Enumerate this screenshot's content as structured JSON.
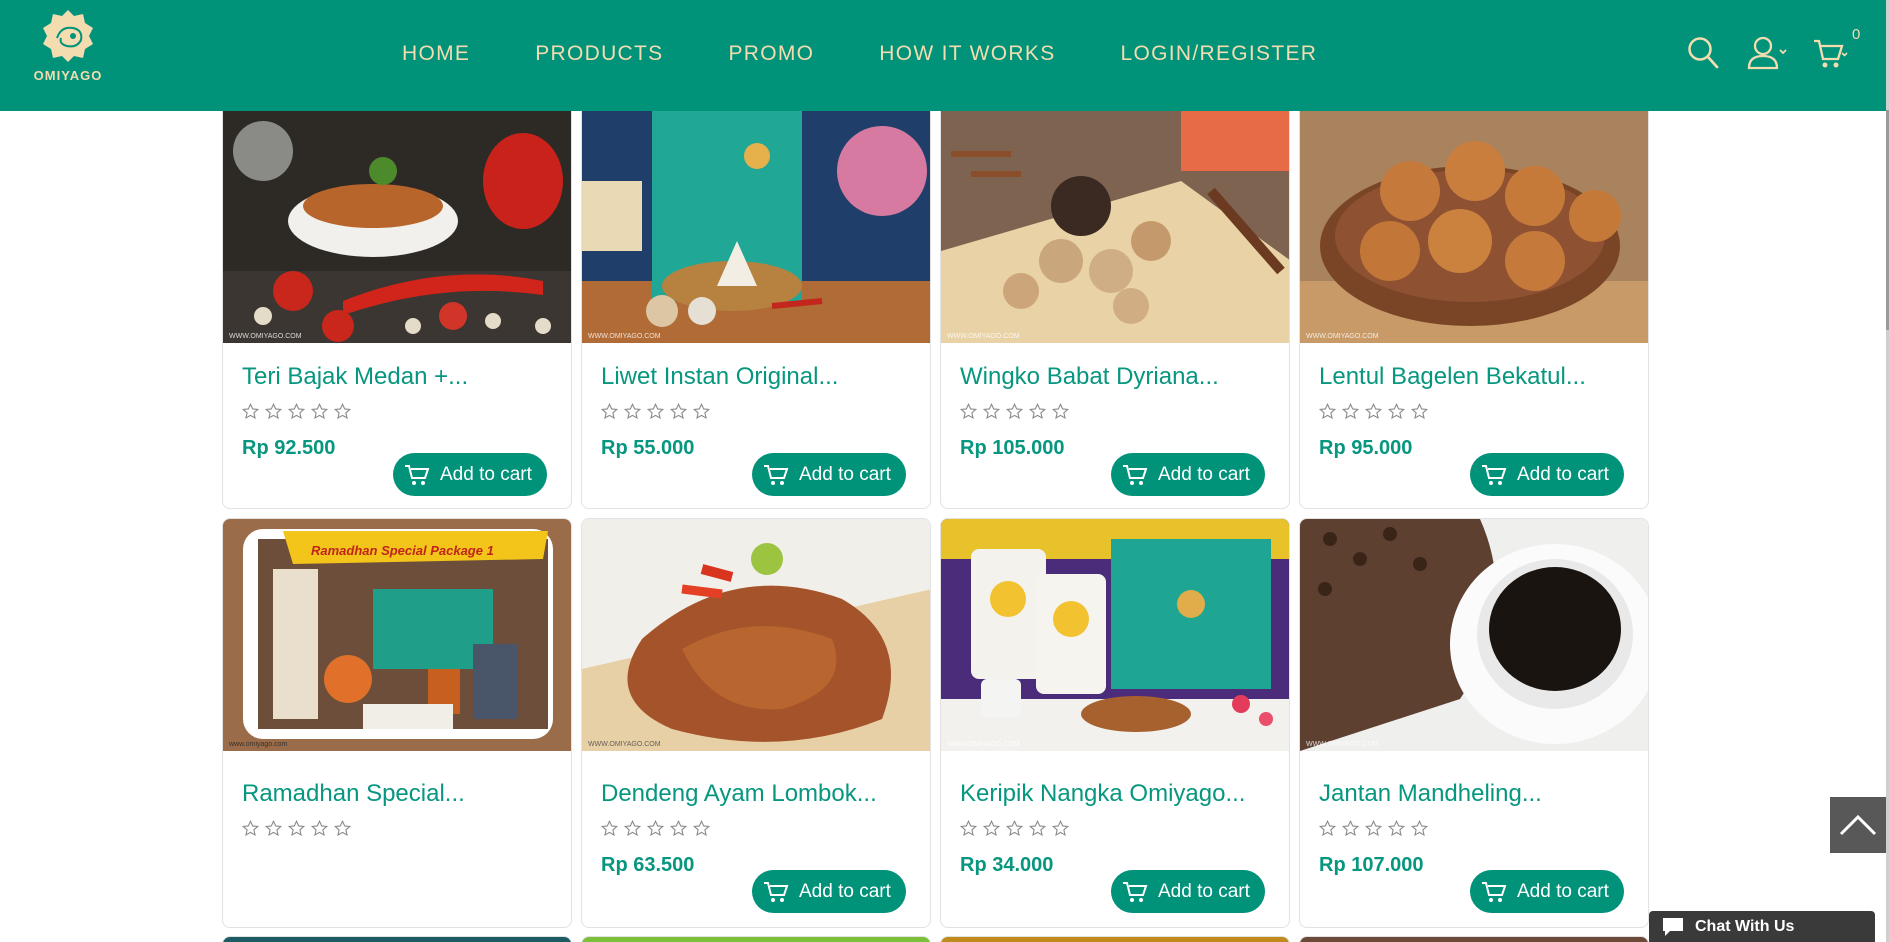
{
  "brand": {
    "logo_text": "OMIYAGO",
    "color": "#01927a",
    "accent": "#f3ddb0"
  },
  "nav": {
    "items": [
      {
        "label": "HOME"
      },
      {
        "label": "PRODUCTS"
      },
      {
        "label": "PROMO"
      },
      {
        "label": "HOW IT WORKS"
      },
      {
        "label": "LOGIN/REGISTER"
      }
    ]
  },
  "header_icons": {
    "search": "search-icon",
    "account": "user-icon",
    "cart": "cart-icon",
    "cart_count": "0"
  },
  "products": [
    {
      "name": "Teri Bajak Medan +...",
      "rating": 0,
      "price": "Rp 92.500",
      "button": "Add to cart",
      "watermark": "WWW.OMIYAGO.COM"
    },
    {
      "name": "Liwet Instan Original...",
      "rating": 0,
      "price": "Rp 55.000",
      "button": "Add to cart",
      "watermark": "WWW.OMIYAGO.COM"
    },
    {
      "name": "Wingko Babat Dyriana...",
      "rating": 0,
      "price": "Rp 105.000",
      "button": "Add to cart",
      "watermark": "WWW.OMIYAGO.COM"
    },
    {
      "name": "Lentul Bagelen Bekatul...",
      "rating": 0,
      "price": "Rp 95.000",
      "button": "Add to cart",
      "watermark": "WWW.OMIYAGO.COM"
    },
    {
      "name": "Ramadhan Special...",
      "rating": 0,
      "price": "",
      "button": "",
      "watermark": "www.omiyago.com",
      "image_banner": "Ramadhan Special Package 1"
    },
    {
      "name": "Dendeng Ayam Lombok...",
      "rating": 0,
      "price": "Rp 63.500",
      "button": "Add to cart",
      "watermark": "WWW.OMIYAGO.COM"
    },
    {
      "name": "Keripik Nangka Omiyago...",
      "rating": 0,
      "price": "Rp 34.000",
      "button": "Add to cart",
      "watermark": "WWW.OMIYAGO.COM"
    },
    {
      "name": "Jantan Mandheling...",
      "rating": 0,
      "price": "Rp 107.000",
      "button": "Add to cart",
      "watermark": "WWW.OMIYAGO.COM"
    }
  ],
  "chat": {
    "label": "Chat With Us"
  },
  "back_to_top": "chevron-up-icon"
}
